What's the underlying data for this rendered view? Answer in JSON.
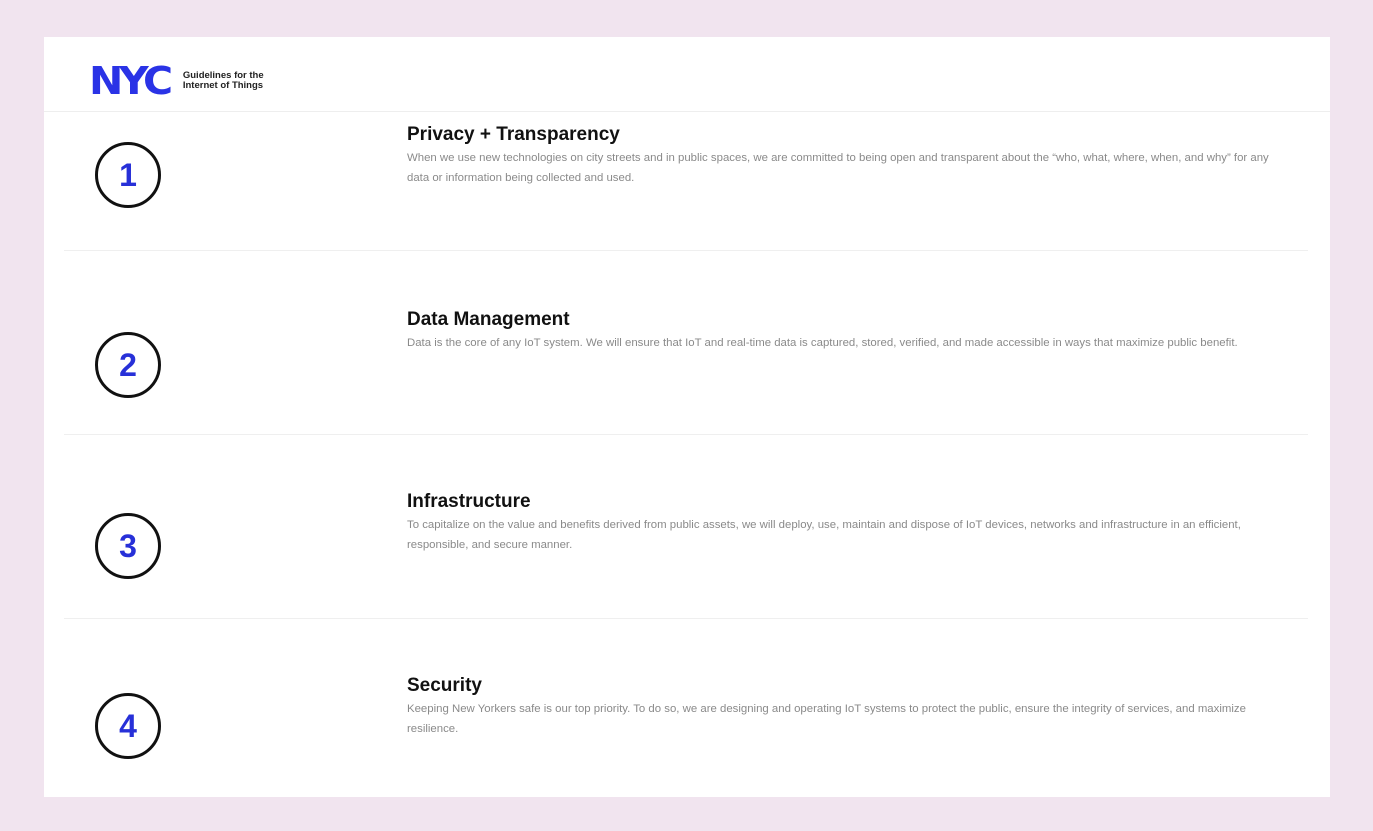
{
  "logo": {
    "mark": "NYC",
    "line1": "Guidelines for the",
    "line2": "Internet of Things"
  },
  "sections": [
    {
      "number": "1",
      "title": "Privacy + Transparency",
      "description": "When we use new technologies on city streets and in public spaces, we are committed to being open and transparent about the “who, what, where, when, and why” for any data or information being collected and used."
    },
    {
      "number": "2",
      "title": "Data Management",
      "description": "Data is the core of any IoT system. We will ensure that IoT and real-time data is captured, stored, verified, and made accessible in ways that maximize public benefit."
    },
    {
      "number": "3",
      "title": "Infrastructure",
      "description": "To capitalize on the value and benefits derived from public assets, we will deploy, use, maintain and dispose of IoT devices, networks and infrastructure in an efficient, responsible, and secure manner."
    },
    {
      "number": "4",
      "title": "Security",
      "description": "Keeping New Yorkers safe is our top priority.  To do so, we are designing and operating IoT systems to protect the public, ensure the integrity of services, and maximize resilience."
    }
  ],
  "colors": {
    "background": "#f1e4ef",
    "brand_blue": "#2a33e6",
    "number_blue": "#2730d8"
  }
}
